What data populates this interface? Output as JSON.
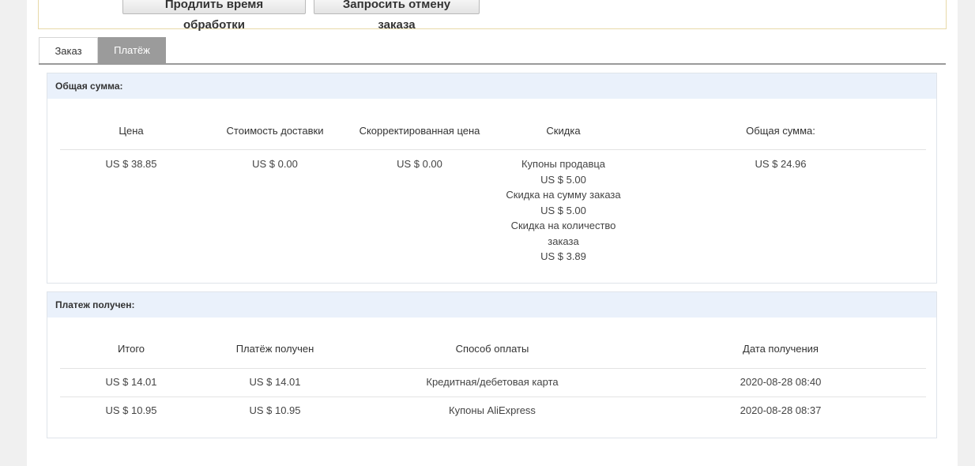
{
  "actions": {
    "extend_label": "Продлить время обработки",
    "cancel_label": "Запросить отмену заказа"
  },
  "tabs": [
    {
      "label": "Заказ",
      "active": false
    },
    {
      "label": "Платёж",
      "active": true
    }
  ],
  "total_panel": {
    "title": "Общая сумма:",
    "headers": [
      "Цена",
      "Стоимость доставки",
      "Скорректированная цена",
      "Скидка",
      "Общая сумма:"
    ],
    "price": "US $ 38.85",
    "shipping": "US $ 0.00",
    "adjusted": "US $ 0.00",
    "discount_lines": [
      "Купоны продавца",
      "US $ 5.00",
      "Скидка на сумму заказа",
      "US $ 5.00",
      "Скидка на количество",
      "заказа",
      "US $ 3.89"
    ],
    "total": "US $ 24.96"
  },
  "paid_panel": {
    "title": "Платеж получен:",
    "headers": [
      "Итого",
      "Платёж получен",
      "Способ оплаты",
      "Дата получения"
    ],
    "rows": [
      {
        "total": "US $ 14.01",
        "received": "US $ 14.01",
        "method": "Кредитная/дебетовая карта",
        "date": "2020-08-28 08:40"
      },
      {
        "total": "US $ 10.95",
        "received": "US $ 10.95",
        "method": "Купоны AliExpress",
        "date": "2020-08-28 08:37"
      }
    ]
  }
}
